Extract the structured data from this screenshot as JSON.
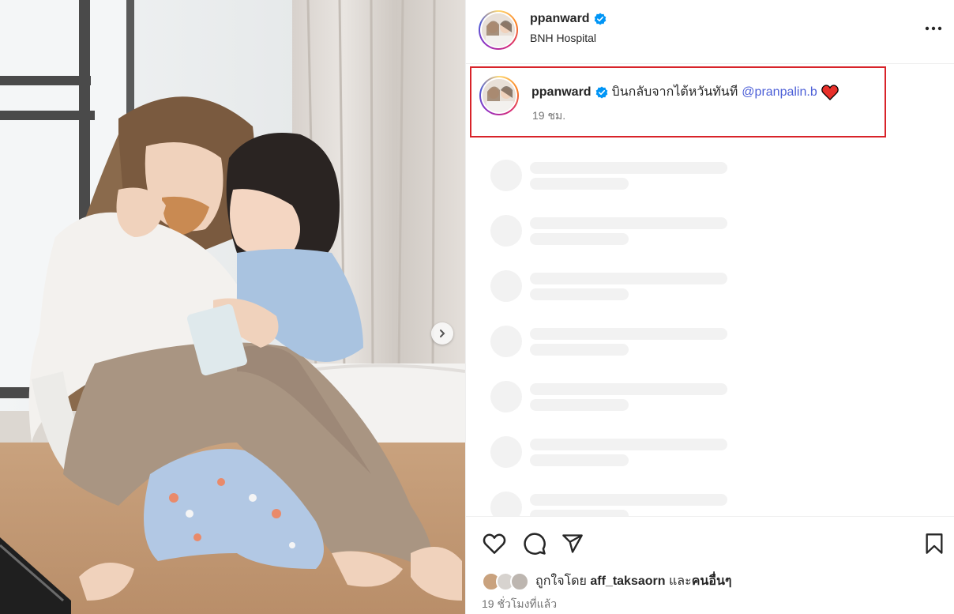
{
  "post": {
    "username": "ppanward",
    "location": "BNH Hospital",
    "more_icon": "more-horizontal-icon"
  },
  "caption": {
    "username": "ppanward",
    "text": "บินกลับจากไต้หวันทันที",
    "mention": "@pranpalin.b",
    "emoji_icon": "red-heart-icon",
    "time": "19 ชม."
  },
  "actions": {
    "like_icon": "heart-outline-icon",
    "comment_icon": "comment-bubble-icon",
    "share_icon": "send-paper-plane-icon",
    "save_icon": "bookmark-icon"
  },
  "likes": {
    "prefix": "ถูกใจโดย",
    "user": "aff_taksaorn",
    "conjunction": "และ",
    "others": "คนอื่นๆ"
  },
  "timestamp": "19 ชั่วโมงที่แล้ว",
  "colors": {
    "verified": "#0095f6",
    "mention": "#4c5fd7",
    "highlight_border": "#d8232a",
    "heart": "#ff3040"
  }
}
